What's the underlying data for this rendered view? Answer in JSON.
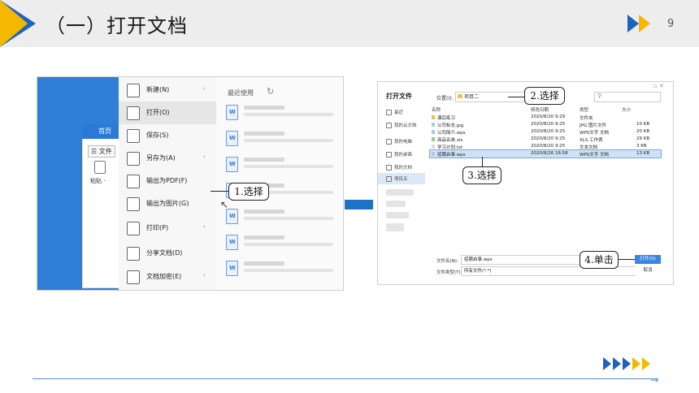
{
  "slide": {
    "title": "（一）打开文档",
    "page_number": "9"
  },
  "left_app": {
    "home_tab": "首页",
    "file_button": "☰ 文件",
    "paste_label": "粘贴 ·",
    "menu": [
      {
        "label": "新建(N)",
        "arrow": "›"
      },
      {
        "label": "打开(O)",
        "arrow": ""
      },
      {
        "label": "保存(S)",
        "arrow": ""
      },
      {
        "label": "另存为(A)",
        "arrow": "›"
      },
      {
        "label": "输出为PDF(F)",
        "arrow": ""
      },
      {
        "label": "输出为图片(G)",
        "arrow": ""
      },
      {
        "label": "打印(P)",
        "arrow": "›"
      },
      {
        "label": "分享文档(D)",
        "arrow": ""
      },
      {
        "label": "文档加密(E)",
        "arrow": "›"
      }
    ],
    "recent_title": "最近使用",
    "callout": "1.选择"
  },
  "dialog": {
    "title": "打开文件",
    "location_label": "位置(I):",
    "location_value": "项目二",
    "sidebar": [
      "最近",
      "我的云文档",
      "我的电脑",
      "我的桌面",
      "我的文档",
      "项目五"
    ],
    "columns": [
      "名称",
      "修改日期",
      "类型",
      "大小"
    ],
    "rows": [
      {
        "name": "课后练习",
        "date": "2020/8/20 9:29",
        "type": "文件夹",
        "size": ""
      },
      {
        "name": "公司标志.jpg",
        "date": "2020/8/20 9:25",
        "type": "JPG 图片文件",
        "size": "10 KB"
      },
      {
        "name": "公司简介.wps",
        "date": "2020/8/20 9:25",
        "type": "WPS文字 文档",
        "size": "20 KB"
      },
      {
        "name": "商品名单.xls",
        "date": "2020/8/20 9:25",
        "type": "XLS 工作表",
        "size": "29 KB"
      },
      {
        "name": "学习计划.txt",
        "date": "2020/8/20 9:25",
        "type": "文本文档",
        "size": "3 KB"
      },
      {
        "name": "招聘启事.wps",
        "date": "2020/8/26 16:58",
        "type": "WPS文字 文档",
        "size": "13 KB"
      }
    ],
    "filename_label": "文件名(N):",
    "filename_value": "招聘启事.wps",
    "filetype_label": "文件类型(T):",
    "filetype_value": "所有文件(*.*)",
    "open_button": "打开(O)",
    "cancel_button": "取消",
    "callout_location": "2.选择",
    "callout_file": "3.选择",
    "callout_open": "4.单击"
  },
  "colors": {
    "accent_blue": "#1e63c0",
    "accent_yellow": "#f5b800",
    "connector_blue": "#1c72c4"
  }
}
